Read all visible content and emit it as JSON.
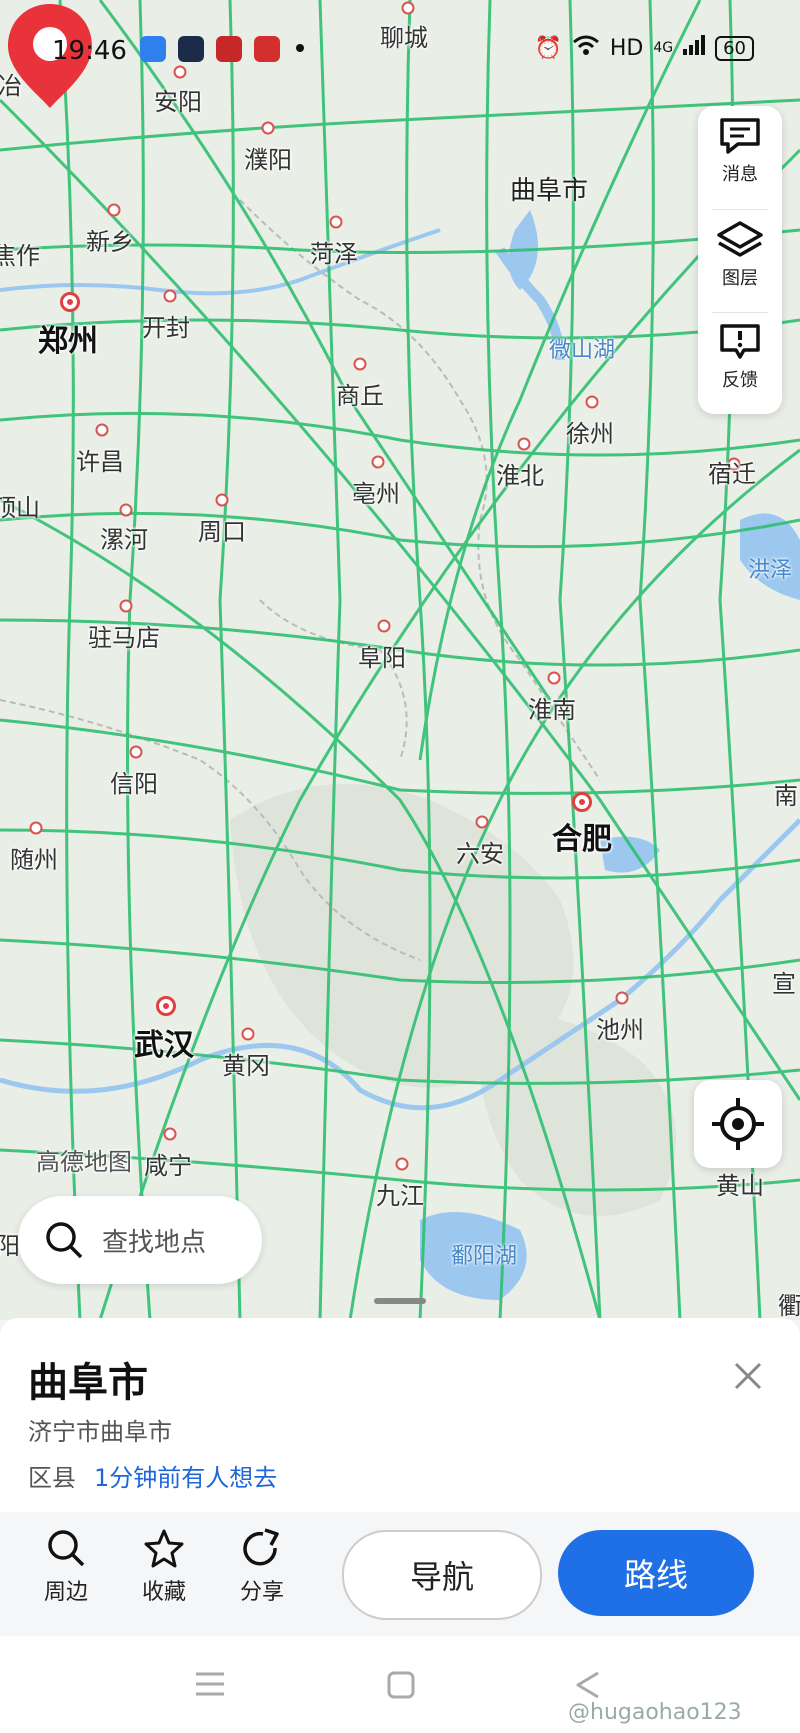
{
  "status_bar": {
    "time": "19:46",
    "network": "HD",
    "signal_type": "4G",
    "battery": "60",
    "app_colors": [
      "#2f80ed",
      "#1c2b4a",
      "#c62828",
      "#d32f2f"
    ]
  },
  "map": {
    "colors": {
      "land": "#e9eee6",
      "road": "#2fbf71",
      "water": "#9cc8ef",
      "border": "#b8bcb6"
    },
    "cities": [
      {
        "name": "聊城"
      },
      {
        "name": "安阳"
      },
      {
        "name": "濮阳"
      },
      {
        "name": "新乡"
      },
      {
        "name": "焦作"
      },
      {
        "name": "菏泽"
      },
      {
        "name": "郑州"
      },
      {
        "name": "开封"
      },
      {
        "name": "商丘"
      },
      {
        "name": "许昌"
      },
      {
        "name": "亳州"
      },
      {
        "name": "淮北"
      },
      {
        "name": "徐州"
      },
      {
        "name": "宿迁"
      },
      {
        "name": "漯河"
      },
      {
        "name": "周口"
      },
      {
        "name": "驻马店"
      },
      {
        "name": "阜阳"
      },
      {
        "name": "淮南"
      },
      {
        "name": "信阳"
      },
      {
        "name": "六安"
      },
      {
        "name": "合肥"
      },
      {
        "name": "随州"
      },
      {
        "name": "武汉"
      },
      {
        "name": "黄冈"
      },
      {
        "name": "咸宁"
      },
      {
        "name": "池州"
      },
      {
        "name": "九江"
      },
      {
        "name": "黄山"
      },
      {
        "name": "宣"
      },
      {
        "name": "南"
      },
      {
        "name": "顶山"
      },
      {
        "name": "冶"
      },
      {
        "name": "阳"
      },
      {
        "name": "衢"
      }
    ],
    "lakes": [
      {
        "name": "微山湖"
      },
      {
        "name": "洪泽"
      },
      {
        "name": "鄱阳湖"
      }
    ],
    "selected_pin_label": "曲阜市",
    "logo": "高德地图"
  },
  "side_panel": {
    "message": "消息",
    "layers": "图层",
    "feedback": "反馈"
  },
  "search": {
    "placeholder": "查找地点"
  },
  "place": {
    "title": "曲阜市",
    "address": "济宁市曲阜市",
    "type": "区县",
    "hot_text": "1分钟前有人想去"
  },
  "actions": {
    "nearby": "周边",
    "favorite": "收藏",
    "share": "分享",
    "navigate": "导航",
    "route": "路线"
  },
  "watermark": "@hugaohao123"
}
